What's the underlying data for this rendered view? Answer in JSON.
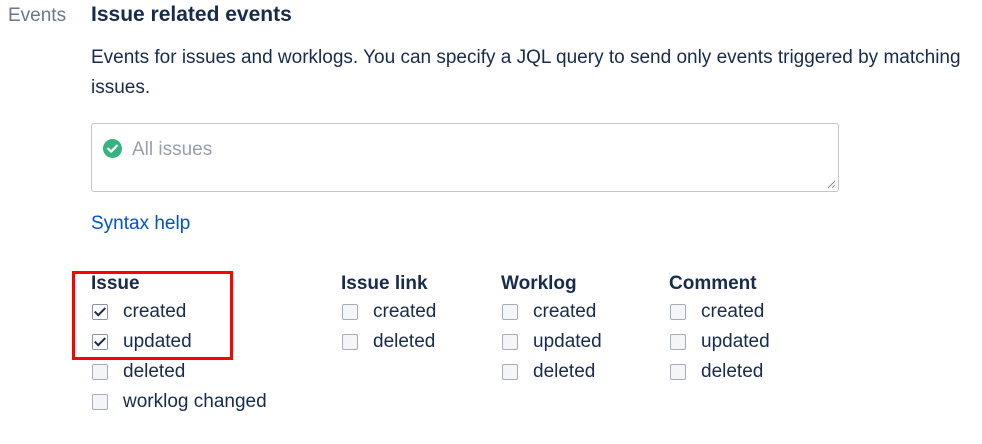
{
  "side_label": "Events",
  "section_title": "Issue related events",
  "description": "Events for issues and worklogs. You can specify a JQL query to send only events triggered by matching issues.",
  "jql": {
    "placeholder": "All issues",
    "value": "",
    "valid_icon": "check-circle-icon",
    "valid_color": "#36b37e"
  },
  "syntax_help": "Syntax help",
  "groups": {
    "issue": {
      "title": "Issue",
      "items": [
        {
          "label": "created",
          "checked": true
        },
        {
          "label": "updated",
          "checked": true
        },
        {
          "label": "deleted",
          "checked": false
        },
        {
          "label": "worklog changed",
          "checked": false
        }
      ]
    },
    "issue_link": {
      "title": "Issue link",
      "items": [
        {
          "label": "created",
          "checked": false
        },
        {
          "label": "deleted",
          "checked": false
        }
      ]
    },
    "worklog": {
      "title": "Worklog",
      "items": [
        {
          "label": "created",
          "checked": false
        },
        {
          "label": "updated",
          "checked": false
        },
        {
          "label": "deleted",
          "checked": false
        }
      ]
    },
    "comment": {
      "title": "Comment",
      "items": [
        {
          "label": "created",
          "checked": false
        },
        {
          "label": "updated",
          "checked": false
        },
        {
          "label": "deleted",
          "checked": false
        }
      ]
    }
  },
  "annotation": {
    "highlight_color": "#ff0000"
  }
}
